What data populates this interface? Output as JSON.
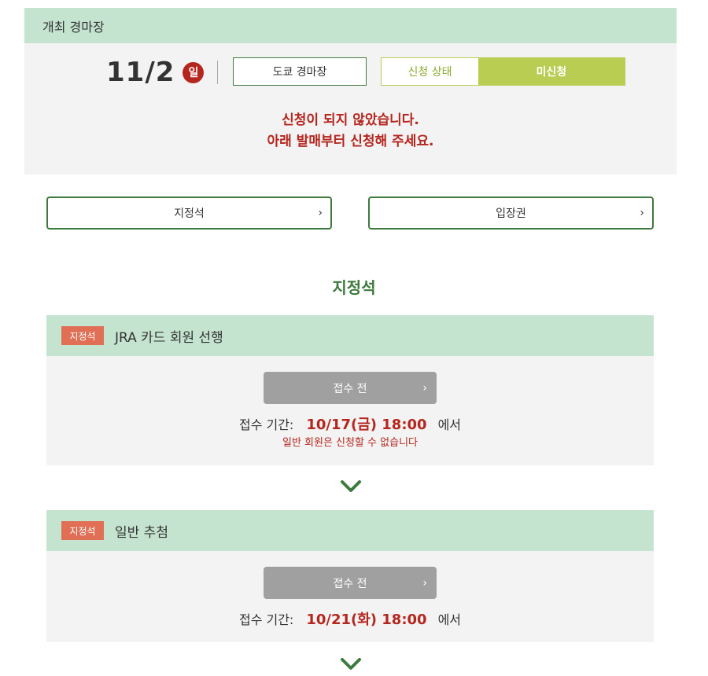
{
  "venue": {
    "header_label": "개최 경마장",
    "date": "11/2",
    "day_of_week": "일",
    "racecourse": "도쿄 경마장",
    "status_label": "신청 상태",
    "status_value": "미신청",
    "warning_line1": "신청이 되지 않았습니다.",
    "warning_line2": "아래 발매부터 신청해 주세요."
  },
  "links": [
    {
      "label": "지정석",
      "chevron": "›"
    },
    {
      "label": "입장권",
      "chevron": "›"
    }
  ],
  "section": {
    "title": "지정석"
  },
  "cards": [
    {
      "tag": "지정석",
      "title": "JRA 카드 회원 선행",
      "button_label": "접수 전",
      "chevron": "›",
      "period_label": "접수 기간:",
      "period_date": "10/17(금) 18:00",
      "period_suffix": "에서",
      "note": "일반 회원은 신청할 수 없습니다"
    },
    {
      "tag": "지정석",
      "title": "일반 추첨",
      "button_label": "접수 전",
      "chevron": "›",
      "period_label": "접수 기간:",
      "period_date": "10/21(화) 18:00",
      "period_suffix": "에서"
    }
  ],
  "colors": {
    "green_dark": "#3d7a3d",
    "green_light": "#c5e4cf",
    "lime": "#b9cd52",
    "red": "#b5261e",
    "tag_orange": "#e06f55",
    "gray_button": "#a0a0a0"
  },
  "icons": {
    "chevron_right": "chevron-right-icon",
    "chevron_down": "chevron-down-icon"
  }
}
